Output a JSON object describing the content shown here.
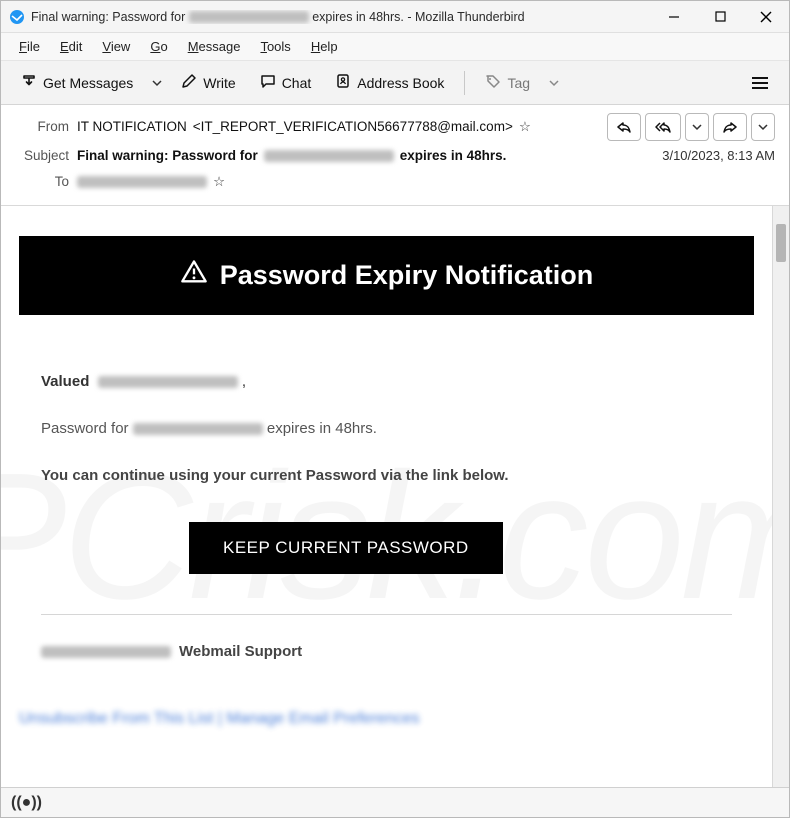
{
  "redacted": "██████████",
  "titlebar": {
    "prefix": "Final warning: Password for ",
    "suffix": " expires in 48hrs. - Mozilla Thunderbird"
  },
  "menus": {
    "file": "File",
    "edit": "Edit",
    "view": "View",
    "go": "Go",
    "message": "Message",
    "tools": "Tools",
    "help": "Help"
  },
  "toolbar": {
    "get_messages": "Get Messages",
    "write": "Write",
    "chat": "Chat",
    "address_book": "Address Book",
    "tag": "Tag"
  },
  "header": {
    "from_label": "From",
    "from_name": "IT NOTIFICATION",
    "from_addr": "<IT_REPORT_VERIFICATION56677788@mail.com>",
    "subject_label": "Subject",
    "subject_prefix": "Final warning: Password for ",
    "subject_suffix": " expires in 48hrs.",
    "to_label": "To",
    "date": "3/10/2023, 8:13 AM"
  },
  "email": {
    "banner": "Password Expiry Notification",
    "valued": "Valued",
    "comma": " ,",
    "pw_for": "Password for ",
    "pw_suffix": " expires in 48hrs.",
    "continue": "You can continue using your current Password via the link below.",
    "button": "KEEP CURRENT PASSWORD",
    "support_suffix": "Webmail Support",
    "footer": "Unsubscribe From This List | Manage Email Preferences"
  },
  "status": {
    "online_symbol": "((●))"
  },
  "watermark": "PCrisk.com"
}
